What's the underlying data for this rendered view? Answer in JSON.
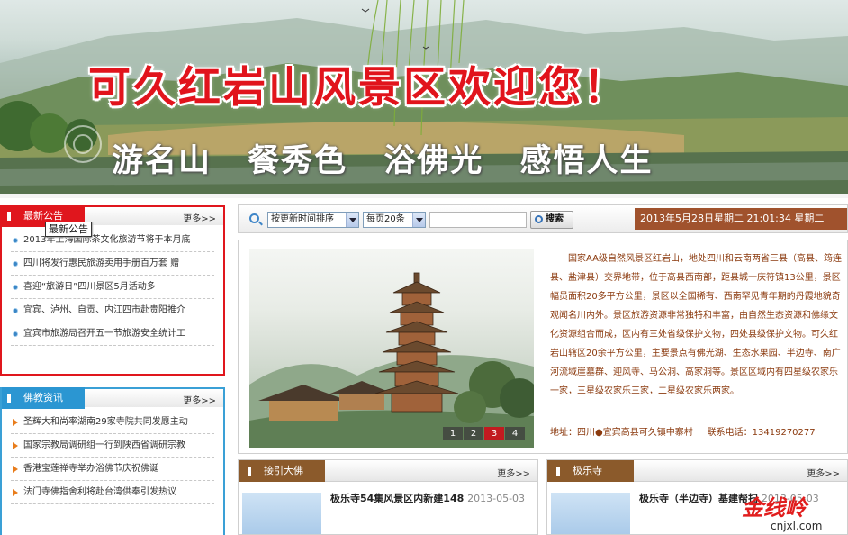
{
  "banner": {
    "title": "可久红岩山风景区欢迎您！",
    "slogan": "游名山  餐秀色  浴佛光  感悟人生"
  },
  "notice": {
    "tab_label": "最新公告",
    "more": "更多>>",
    "tooltip": "最新公告",
    "items": [
      "2013年上海国际茶文化旅游节将于本月底",
      "四川将发行惠民旅游卖用手册百万套 赠",
      "喜迎“旅游日”四川景区5月活动多",
      "宜宾、泸州、自贡、内江四市赴贵阳推介",
      "宜宾市旅游局召开五一节旅游安全统计工"
    ]
  },
  "buddhism": {
    "tab_label": "佛教资讯",
    "more": "更多>>",
    "items": [
      "圣辉大和尚率湖南29家寺院共同发愿主动",
      "国家宗教局调研组一行到陕西省调研宗教",
      "香港宝莲禅寺举办浴佛节庆祝佛诞",
      "法门寺佛指舍利将赴台湾供奉引发热议"
    ]
  },
  "toolbar": {
    "sort_select": "按更新时间排序",
    "per_page_select": "每页20条",
    "search_value": "",
    "search_button": "搜索",
    "datetime": "2013年5月28日星期二 21:01:34 星期二"
  },
  "main": {
    "slide_numbers": [
      "1",
      "2",
      "3",
      "4"
    ],
    "active_slide": "3",
    "intro": "国家AA级自然风景区红岩山，地处四川和云南两省三县（高县、筠连县、盐津县）交界地带，位于高县西南部，距县城一庆符镇13公里，景区幅员面积20多平方公里，景区以全国稀有、西南罕见青年期的丹霞地貌奇观闻名川内外。景区旅游资源非常独特和丰富，由自然生态资源和佛缘文化资源组合而成，区内有三处省级保护文物，四处县级保护文物。可久红岩山辖区20余平方公里，主要景点有佛光湖、生态水果园、半边寺、南广河流域崖墓群、迎风寺、马公洞、高家洞等。景区区域内有四星级农家乐一家，三星级农家乐三家，二星级农家乐两家。",
    "address_label": "地址：四川●宜宾高县可久镇中寨村",
    "phone_label": "联系电话：13419270277"
  },
  "bottom_left": {
    "tab_label": "接引大佛",
    "more": "更多>>",
    "item_title": "极乐寺54集风景区内新建148",
    "item_date": "2013-05-03"
  },
  "bottom_right": {
    "tab_label": "极乐寺",
    "more": "更多>>",
    "item_title": "极乐寺（半边寺）基建帮扫",
    "item_date": "2013-05-03"
  },
  "watermark": {
    "logo_text": "金线岭",
    "domain": "cnjxl.com"
  },
  "colors": {
    "accent_red": "#e0161d",
    "accent_blue": "#2b96d2",
    "brown": "#8b5a2b",
    "date_bg": "#a0522d",
    "text_brown": "#8b3a0e"
  }
}
